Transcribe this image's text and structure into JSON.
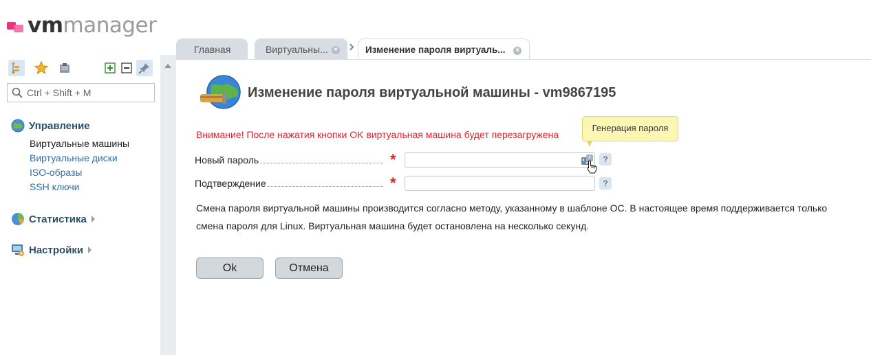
{
  "logo": {
    "part1": "vm",
    "part2": "manager"
  },
  "sidebar": {
    "search_placeholder": "Ctrl + Shift + M",
    "groups": [
      {
        "label": "Управление",
        "icon": "globe-icon",
        "items": [
          "Виртуальные машины",
          "Виртуальные диски",
          "ISO-образы",
          "SSH ключи"
        ]
      },
      {
        "label": "Статистика",
        "icon": "pie-chart-icon"
      },
      {
        "label": "Настройки",
        "icon": "settings-monitor-icon"
      }
    ]
  },
  "tabs": [
    {
      "label": "Главная"
    },
    {
      "label": "Виртуальны..."
    },
    {
      "label": "Изменение пароля виртуаль..."
    }
  ],
  "form": {
    "title": "Изменение пароля виртуальной машины - vm9867195",
    "warning": "Внимание! После нажатия кнопки OK виртуальная машина будет перезагружена",
    "new_password_label": "Новый пароль",
    "confirm_label": "Подтверждение",
    "new_password_value": "",
    "confirm_value": "",
    "tooltip": "Генерация пароля",
    "help_glyph": "?",
    "required_mark": "*",
    "description": "Смена пароля виртуальной машины производится согласно методу, указанному в шаблоне ОС. В настоящее время поддерживается только смена пароля для Linux. Виртуальная машина будет остановлена на несколько секунд.",
    "ok_label": "Ok",
    "cancel_label": "Отмена"
  },
  "colors": {
    "warning": "#e0232c",
    "link": "#2e6da4",
    "group_heading": "#2b4f6b",
    "tooltip_bg": "#fcf6b4"
  }
}
